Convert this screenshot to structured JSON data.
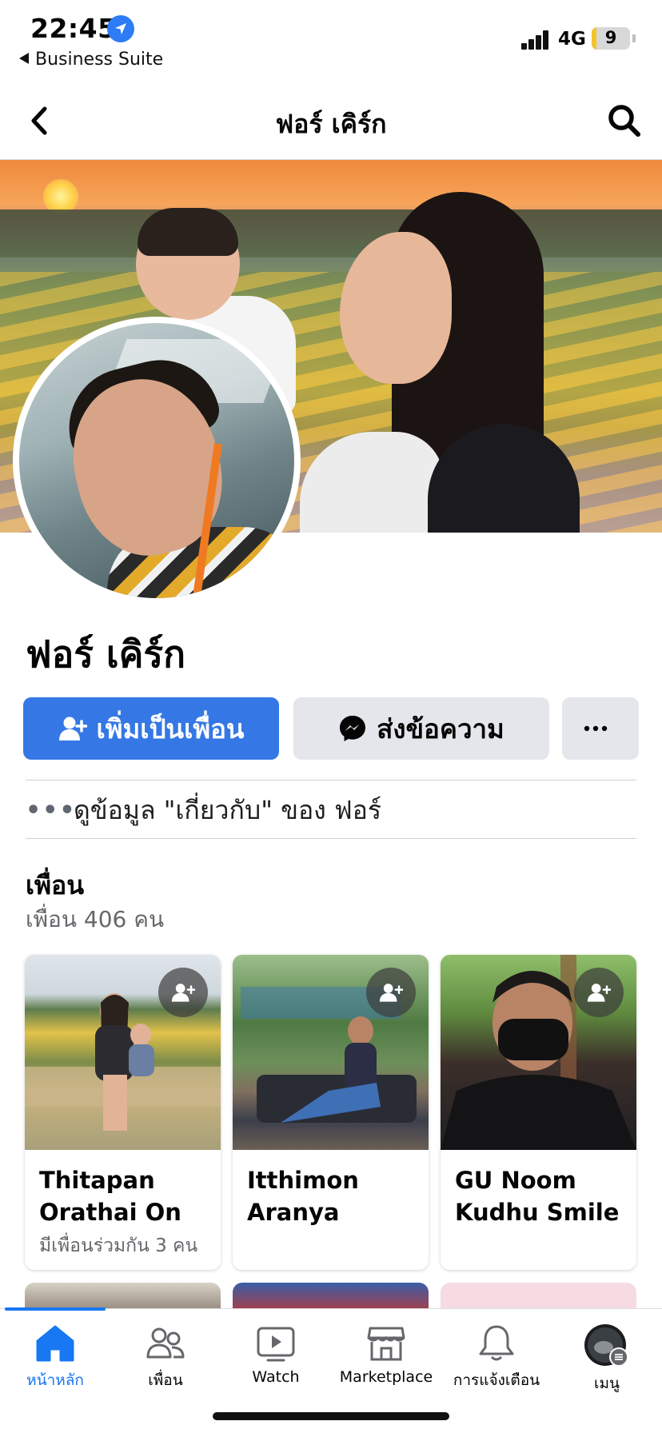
{
  "status_bar": {
    "time": "22:45",
    "back_app": "Business Suite",
    "network": "4G",
    "battery": "9",
    "location_icon": "location-arrow-icon"
  },
  "header": {
    "title": "ฟอร์ เคิร์ก",
    "back_icon": "chevron-left-icon",
    "search_icon": "search-icon"
  },
  "profile": {
    "name": "ฟอร์ เคิร์ก"
  },
  "actions": {
    "add_friend": "เพิ่มเป็นเพื่อน",
    "message": "ส่งข้อความ",
    "more_icon": "more-dots-icon",
    "accent": "#3578e5"
  },
  "about": {
    "dots": "•••",
    "text": "ดูข้อมูล \"เกี่ยวกับ\" ของ ฟอร์"
  },
  "friends": {
    "title": "เพื่อน",
    "count": "เพื่อน 406 คน",
    "cards": [
      {
        "name": "Thitapan Orathai On",
        "mutual": "มีเพื่อนร่วมกัน 3 คน"
      },
      {
        "name": "Itthimon Aranya",
        "mutual": ""
      },
      {
        "name": "GU Noom Kudhu Smile",
        "mutual": ""
      }
    ]
  },
  "tabbar": {
    "active_color": "#1877f2",
    "tabs": [
      {
        "label": "หน้าหลัก",
        "icon": "home-icon"
      },
      {
        "label": "เพื่อน",
        "icon": "friends-icon"
      },
      {
        "label": "Watch",
        "icon": "watch-icon"
      },
      {
        "label": "Marketplace",
        "icon": "marketplace-icon"
      },
      {
        "label": "การแจ้งเตือน",
        "icon": "bell-icon"
      },
      {
        "label": "เมนู",
        "icon": "menu-avatar-icon"
      }
    ]
  }
}
